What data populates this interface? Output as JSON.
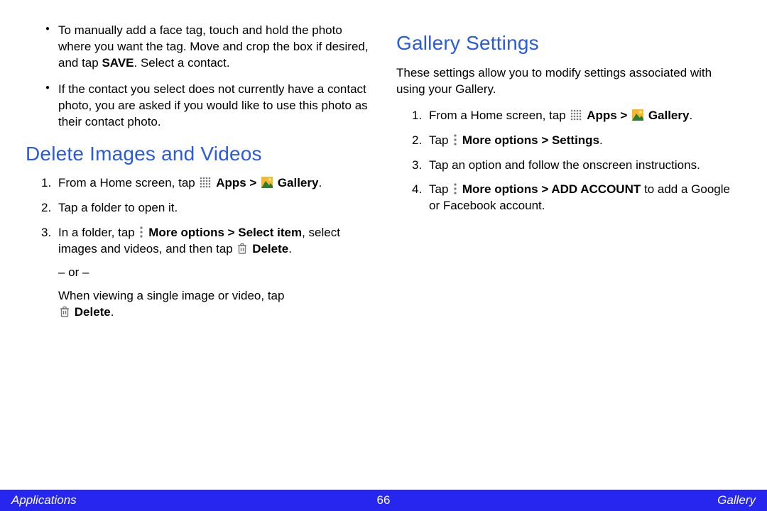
{
  "left": {
    "bullets": [
      {
        "pre": "To manually add a face tag, touch and hold the photo where you want the tag. Move and crop the box if desired, and tap ",
        "boldA": "SAVE",
        "post": ". Select a contact."
      },
      {
        "text": "If the contact you select does not currently have a contact photo, you are asked if you would like to use this photo as their contact photo."
      }
    ],
    "heading": "Delete Images and Videos",
    "step1_pre": "From a Home screen, tap ",
    "step1_apps": "Apps > ",
    "step1_gallery": "Gallery",
    "step2": "Tap a folder to open it.",
    "step3_pre": "In a folder, tap ",
    "step3_more": "More options > Select item",
    "step3_mid": ", select images and videos, and then tap ",
    "step3_delete": "Delete",
    "step3_or": "– or –",
    "step3_alt_pre": "When viewing a single image or video, tap ",
    "step3_alt_delete": "Delete"
  },
  "right": {
    "heading": "Gallery Settings",
    "intro": "These settings allow you to modify settings associated with using your Gallery.",
    "step1_pre": "From a Home screen, tap ",
    "step1_apps": "Apps > ",
    "step1_gallery": "Gallery",
    "step2_pre": "Tap ",
    "step2_more": "More options > Settings",
    "step3": "Tap an option and follow the onscreen instructions.",
    "step4_pre": "Tap ",
    "step4_more": "More options > ADD ACCOUNT",
    "step4_post": " to add a Google or Facebook account."
  },
  "footer": {
    "left": "Applications",
    "center": "66",
    "right": "Gallery"
  }
}
